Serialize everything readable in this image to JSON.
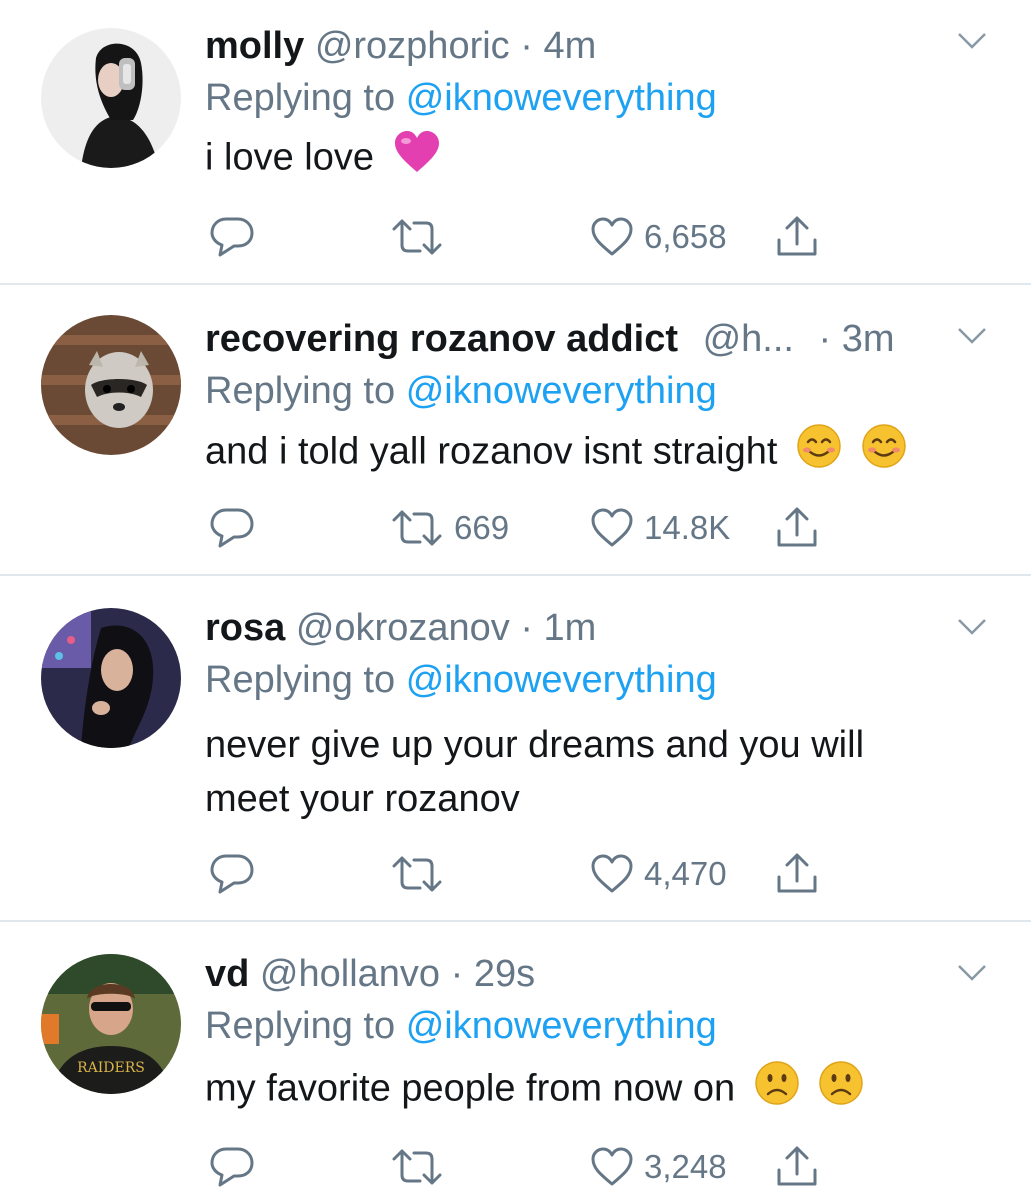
{
  "colors": {
    "link": "#1da1f2",
    "secondary": "#657786",
    "divider": "#e1e8ed",
    "text": "#14171a"
  },
  "icons": {
    "reply": "speech-bubble-icon",
    "retweet": "retweet-arrows-icon",
    "like": "heart-outline-icon",
    "share": "share-upload-icon",
    "caret": "chevron-down-icon"
  },
  "tweets": [
    {
      "display_name": "molly",
      "handle": "@rozphoric",
      "separator": "·",
      "time": "4m",
      "reply_prefix": "Replying to",
      "reply_to": "@iknoweverything",
      "text": "i love love",
      "emojis": [
        "pink-heart"
      ],
      "retweets": "",
      "likes": "6,658"
    },
    {
      "display_name": "recovering rozanov addict",
      "handle": "@h...",
      "separator": "·",
      "time": "3m",
      "reply_prefix": "Replying to",
      "reply_to": "@iknoweverything",
      "text": "and i told yall rozanov isnt straight",
      "emojis": [
        "smiling-face",
        "smiling-face"
      ],
      "retweets": "669",
      "likes": "14.8K"
    },
    {
      "display_name": "rosa",
      "handle": "@okrozanov",
      "separator": "·",
      "time": "1m",
      "reply_prefix": "Replying to",
      "reply_to": "@iknoweverything",
      "text_line1": "never give up your dreams and you will",
      "text_line2": "meet your rozanov",
      "emojis": [],
      "retweets": "",
      "likes": "4,470"
    },
    {
      "display_name": "vd",
      "handle": "@hollanvo",
      "separator": "·",
      "time": "29s",
      "reply_prefix": "Replying to",
      "reply_to": "@iknoweverything",
      "text": "my favorite people from now on",
      "emojis": [
        "frowning-face",
        "frowning-face"
      ],
      "retweets": "",
      "likes": "3,248"
    }
  ]
}
